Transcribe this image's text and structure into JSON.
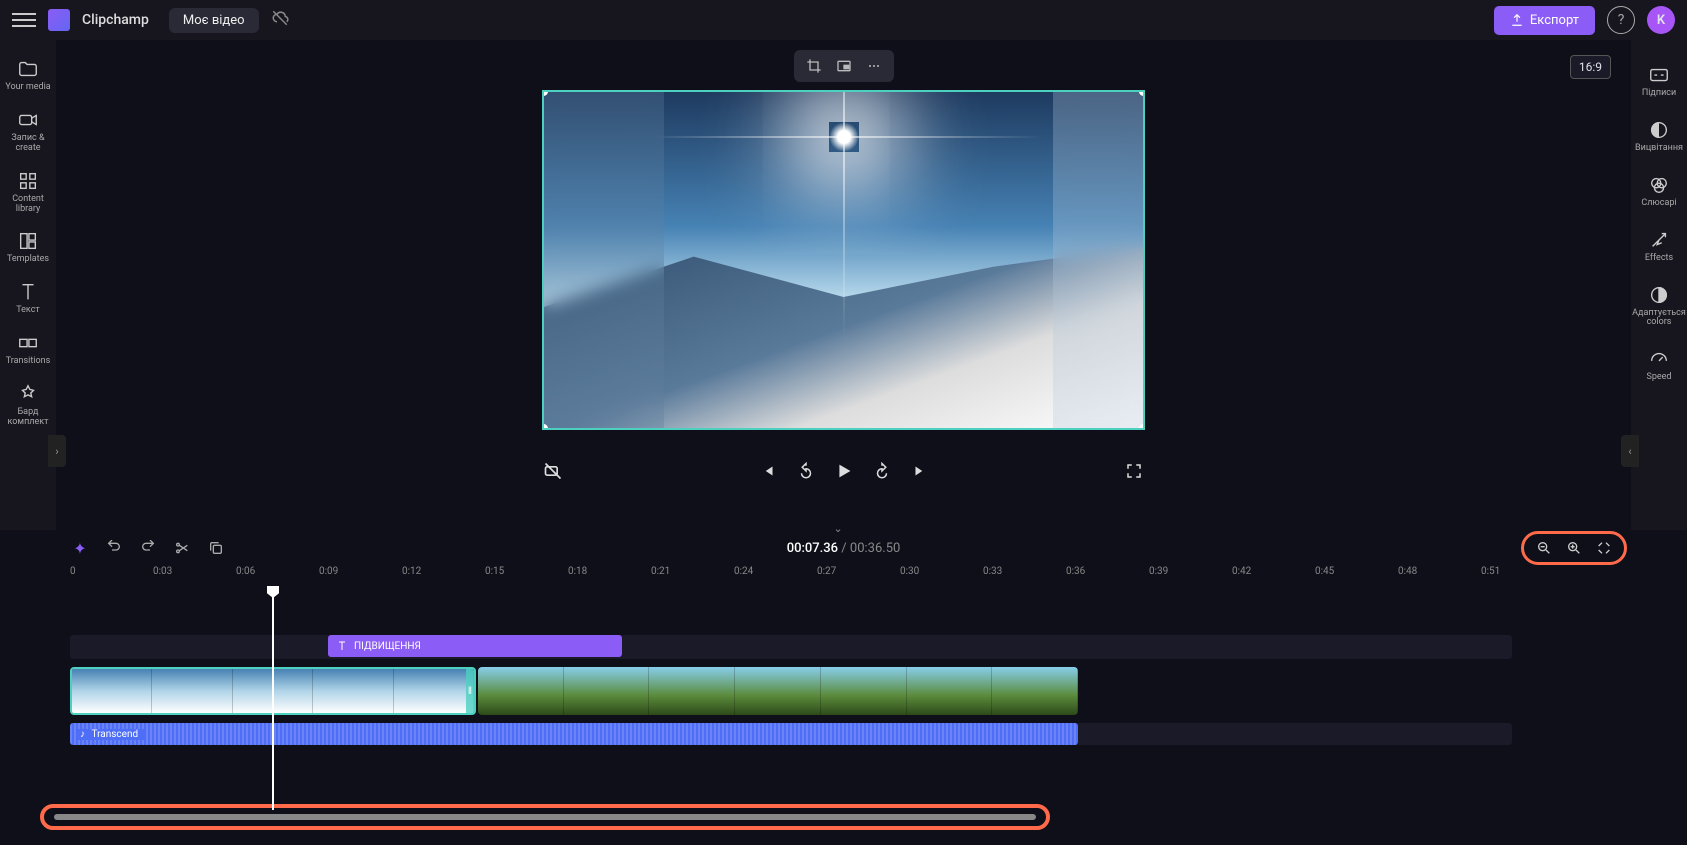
{
  "header": {
    "brand": "Clipchamp",
    "project_title": "Моє відео",
    "export_label": "Експорт",
    "avatar_initial": "K"
  },
  "left_rail": {
    "items": [
      {
        "label": "Your media"
      },
      {
        "label": "Запис &amp; create"
      },
      {
        "label": "Content library"
      },
      {
        "label": "Templates"
      },
      {
        "label": "Текст"
      },
      {
        "label": "Transitions"
      },
      {
        "label": "Бард комплект"
      }
    ]
  },
  "right_rail": {
    "items": [
      {
        "label": "Підписи"
      },
      {
        "label": "Вицвітання"
      },
      {
        "label": "Слюсарі"
      },
      {
        "label": "Effects"
      },
      {
        "label": "Адаптується colors"
      },
      {
        "label": "Speed"
      }
    ]
  },
  "preview": {
    "aspect_ratio": "16:9"
  },
  "timeline": {
    "current_time": "00:07.36",
    "total_time": "00:36.50",
    "ruler_ticks": [
      "0",
      "0:03",
      "0:06",
      "0:09",
      "0:12",
      "0:15",
      "0:18",
      "0:21",
      "0:24",
      "0:27",
      "0:30",
      "0:33",
      "0:36",
      "0:39",
      "0:42",
      "0:45",
      "0:48",
      "0:51"
    ],
    "text_clip_label": "ПІДВИЩЕННЯ",
    "audio_clip_label": "Transcend"
  }
}
